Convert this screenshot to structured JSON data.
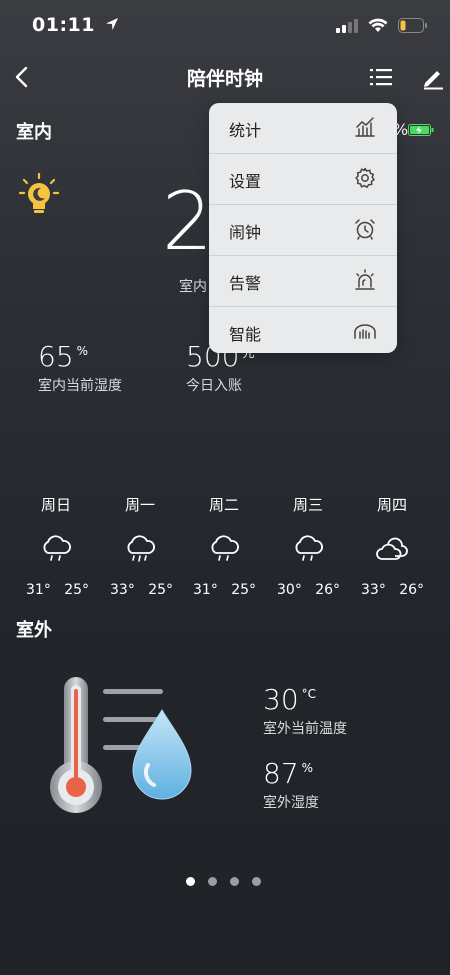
{
  "status": {
    "time": "01:11"
  },
  "nav": {
    "title": "陪伴时钟"
  },
  "indoor": {
    "section_title": "室内",
    "temperature": "2",
    "temperature_label": "室内",
    "battery_percent": "%",
    "humidity": {
      "value": "65",
      "unit": "%",
      "label": "室内当前湿度"
    },
    "income": {
      "value": "500",
      "unit": "元",
      "label": "今日入账"
    }
  },
  "forecast": [
    {
      "day": "周日",
      "high": "31°",
      "low": "25°",
      "icon": "cloud-drizzle-icon"
    },
    {
      "day": "周一",
      "high": "33°",
      "low": "25°",
      "icon": "cloud-rain-icon"
    },
    {
      "day": "周二",
      "high": "31°",
      "low": "25°",
      "icon": "cloud-drizzle-icon"
    },
    {
      "day": "周三",
      "high": "30°",
      "low": "26°",
      "icon": "cloud-drizzle-icon"
    },
    {
      "day": "周四",
      "high": "33°",
      "low": "26°",
      "icon": "cloudy-icon"
    }
  ],
  "outdoor": {
    "section_title": "室外",
    "temperature": {
      "value": "30",
      "unit": "°C",
      "label": "室外当前温度"
    },
    "humidity": {
      "value": "87",
      "unit": "%",
      "label": "室外湿度"
    }
  },
  "pager": {
    "pages": 4,
    "active": 0
  },
  "menu": {
    "items": [
      {
        "label": "统计",
        "icon": "stats-chart-icon"
      },
      {
        "label": "设置",
        "icon": "gear-icon"
      },
      {
        "label": "闹钟",
        "icon": "alarm-clock-icon"
      },
      {
        "label": "告警",
        "icon": "alarm-siren-icon"
      },
      {
        "label": "智能",
        "icon": "smart-home-icon"
      }
    ]
  },
  "colors": {
    "accent_yellow": "#f5c242",
    "battery_green": "#4cd964",
    "menu_bg": "#e9eaec"
  }
}
